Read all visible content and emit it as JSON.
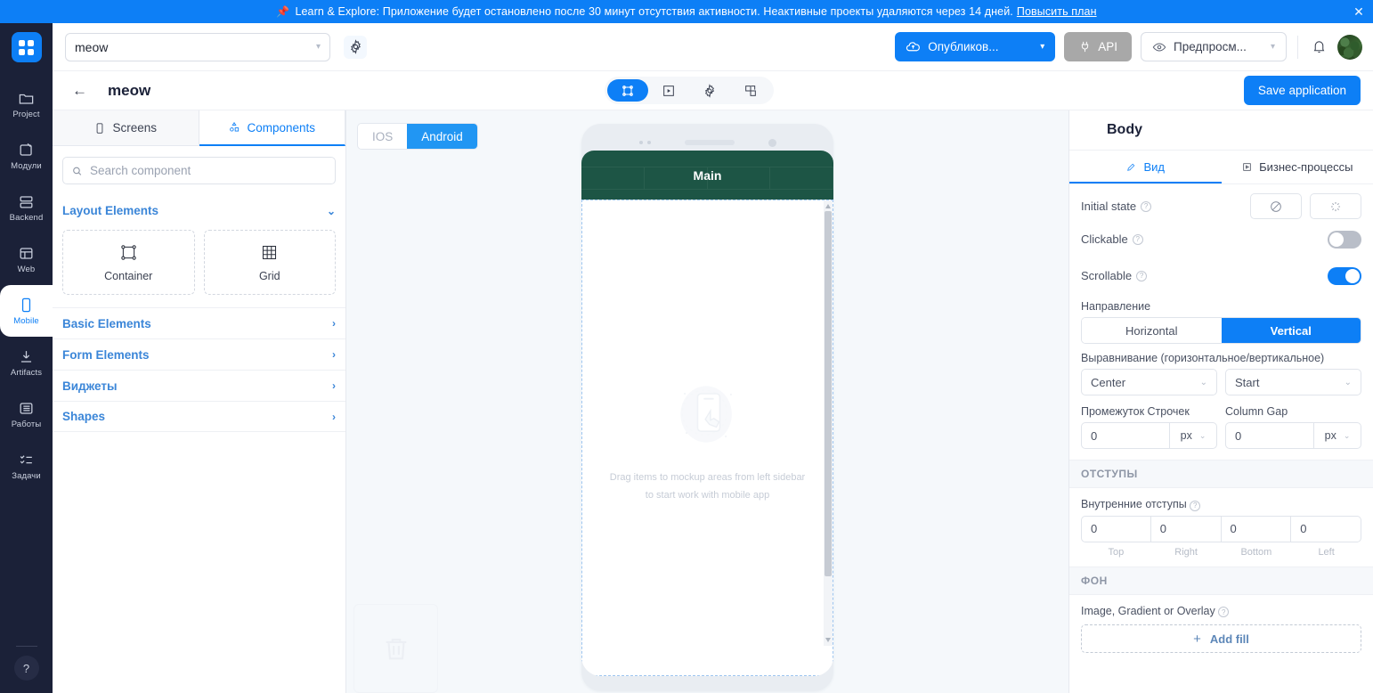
{
  "banner": {
    "pin_icon": "pushpin-icon",
    "text": "Learn & Explore: Приложение будет остановлено после 30 минут отсутствия активности. Неактивные проекты удаляются через 14 дней.",
    "link": "Повысить план",
    "close": "✕",
    "bg_color": "#0d7ff6"
  },
  "rail": {
    "logo_name": "app-logo",
    "items": [
      {
        "label": "Project",
        "icon": "folder-icon",
        "active": false
      },
      {
        "label": "Модули",
        "icon": "modules-icon",
        "active": false
      },
      {
        "label": "Backend",
        "icon": "server-icon",
        "active": false
      },
      {
        "label": "Web",
        "icon": "browser-icon",
        "active": false
      },
      {
        "label": "Mobile",
        "icon": "phone-icon",
        "active": true
      },
      {
        "label": "Artifacts",
        "icon": "download-icon",
        "active": false
      },
      {
        "label": "Работы",
        "icon": "list-icon",
        "active": false
      },
      {
        "label": "Задачи",
        "icon": "tasks-icon",
        "active": false
      }
    ],
    "help_icon": "help-circle-icon"
  },
  "header": {
    "project_select": {
      "value": "meow",
      "caret_icon": "chevron-down-icon"
    },
    "settings_icon": "gear-icon",
    "publish": {
      "label": "Опубликов...",
      "icon": "cloud-upload-icon",
      "caret_icon": "chevron-down-icon",
      "color": "#0d7ff6"
    },
    "api": {
      "label": "API",
      "icon": "plug-icon",
      "color": "#a8a8a8"
    },
    "preview": {
      "label": "Предпросм...",
      "icon": "eye-icon",
      "caret_icon": "chevron-down-icon"
    },
    "bell_icon": "bell-icon",
    "avatar_name": "user-avatar"
  },
  "subheader": {
    "back_icon": "arrow-left-icon",
    "title": "meow",
    "mode_pills": [
      {
        "icon": "frame-icon",
        "active": true
      },
      {
        "icon": "play-box-icon",
        "active": false
      },
      {
        "icon": "gear-icon",
        "active": false
      },
      {
        "icon": "puzzle-icon",
        "active": false
      }
    ],
    "save_label": "Save application"
  },
  "left_panel": {
    "tabs": [
      {
        "label": "Screens",
        "icon": "phone-icon",
        "active": false
      },
      {
        "label": "Components",
        "icon": "components-icon",
        "active": true
      }
    ],
    "search": {
      "placeholder": "Search component",
      "value": "",
      "icon": "search-icon"
    },
    "sections": [
      {
        "label": "Layout Elements",
        "expanded": true,
        "chevron": "chevron-down-icon"
      },
      {
        "label": "Basic Elements",
        "expanded": false,
        "chevron": "chevron-right-icon"
      },
      {
        "label": "Form Elements",
        "expanded": false,
        "chevron": "chevron-right-icon"
      },
      {
        "label": "Виджеты",
        "expanded": false,
        "chevron": "chevron-right-icon"
      },
      {
        "label": "Shapes",
        "expanded": false,
        "chevron": "chevron-right-icon"
      }
    ],
    "layout_components": [
      {
        "label": "Container",
        "icon": "container-icon"
      },
      {
        "label": "Grid",
        "icon": "grid-icon"
      }
    ]
  },
  "canvas": {
    "os_toggle": [
      {
        "label": "IOS",
        "active": false
      },
      {
        "label": "Android",
        "active": true
      }
    ],
    "phone": {
      "appbar_title": "Main",
      "appbar_color": "#1d5545",
      "empty_illustration": "phone-tap-illustration",
      "empty_text_line1": "Drag items to mockup areas from left sidebar",
      "empty_text_line2": "to start work with mobile app",
      "scrollbar": "vertical-scrollbar"
    },
    "trash_icon": "trash-icon"
  },
  "right_panel": {
    "title": "Body",
    "tabs": [
      {
        "label": "Вид",
        "icon": "brush-icon",
        "active": true
      },
      {
        "label": "Бизнес-процессы",
        "icon": "process-icon",
        "active": false
      }
    ],
    "initial_state": {
      "label": "Initial state",
      "help": "?",
      "options": [
        {
          "icon": "disabled-icon",
          "name": "initial-state-none"
        },
        {
          "icon": "loading-spinner-icon",
          "name": "initial-state-loading"
        }
      ]
    },
    "clickable": {
      "label": "Clickable",
      "help": "?",
      "value": false
    },
    "scrollable": {
      "label": "Scrollable",
      "help": "?",
      "value": true
    },
    "direction": {
      "label": "Направление",
      "options": [
        {
          "label": "Horizontal",
          "active": false
        },
        {
          "label": "Vertical",
          "active": true
        }
      ]
    },
    "alignment": {
      "label": "Выравнивание (горизонтальное/вертикальное)",
      "horizontal": "Center",
      "vertical": "Start",
      "caret_icon": "chevron-down-icon"
    },
    "row_gap": {
      "label": "Промежуток Строчек",
      "value": "0",
      "unit": "px"
    },
    "column_gap": {
      "label": "Column Gap",
      "value": "0",
      "unit": "px"
    },
    "padding_section": {
      "header": "ОТСТУПЫ",
      "label": "Внутренние отступы",
      "help": "?",
      "fields": [
        {
          "caption": "Top",
          "value": "0"
        },
        {
          "caption": "Right",
          "value": "0"
        },
        {
          "caption": "Bottom",
          "value": "0"
        },
        {
          "caption": "Left",
          "value": "0"
        }
      ]
    },
    "background_section": {
      "header": "ФОН",
      "label": "Image, Gradient or Overlay",
      "help": "?",
      "add_fill": "Add fill",
      "plus": "+"
    }
  }
}
